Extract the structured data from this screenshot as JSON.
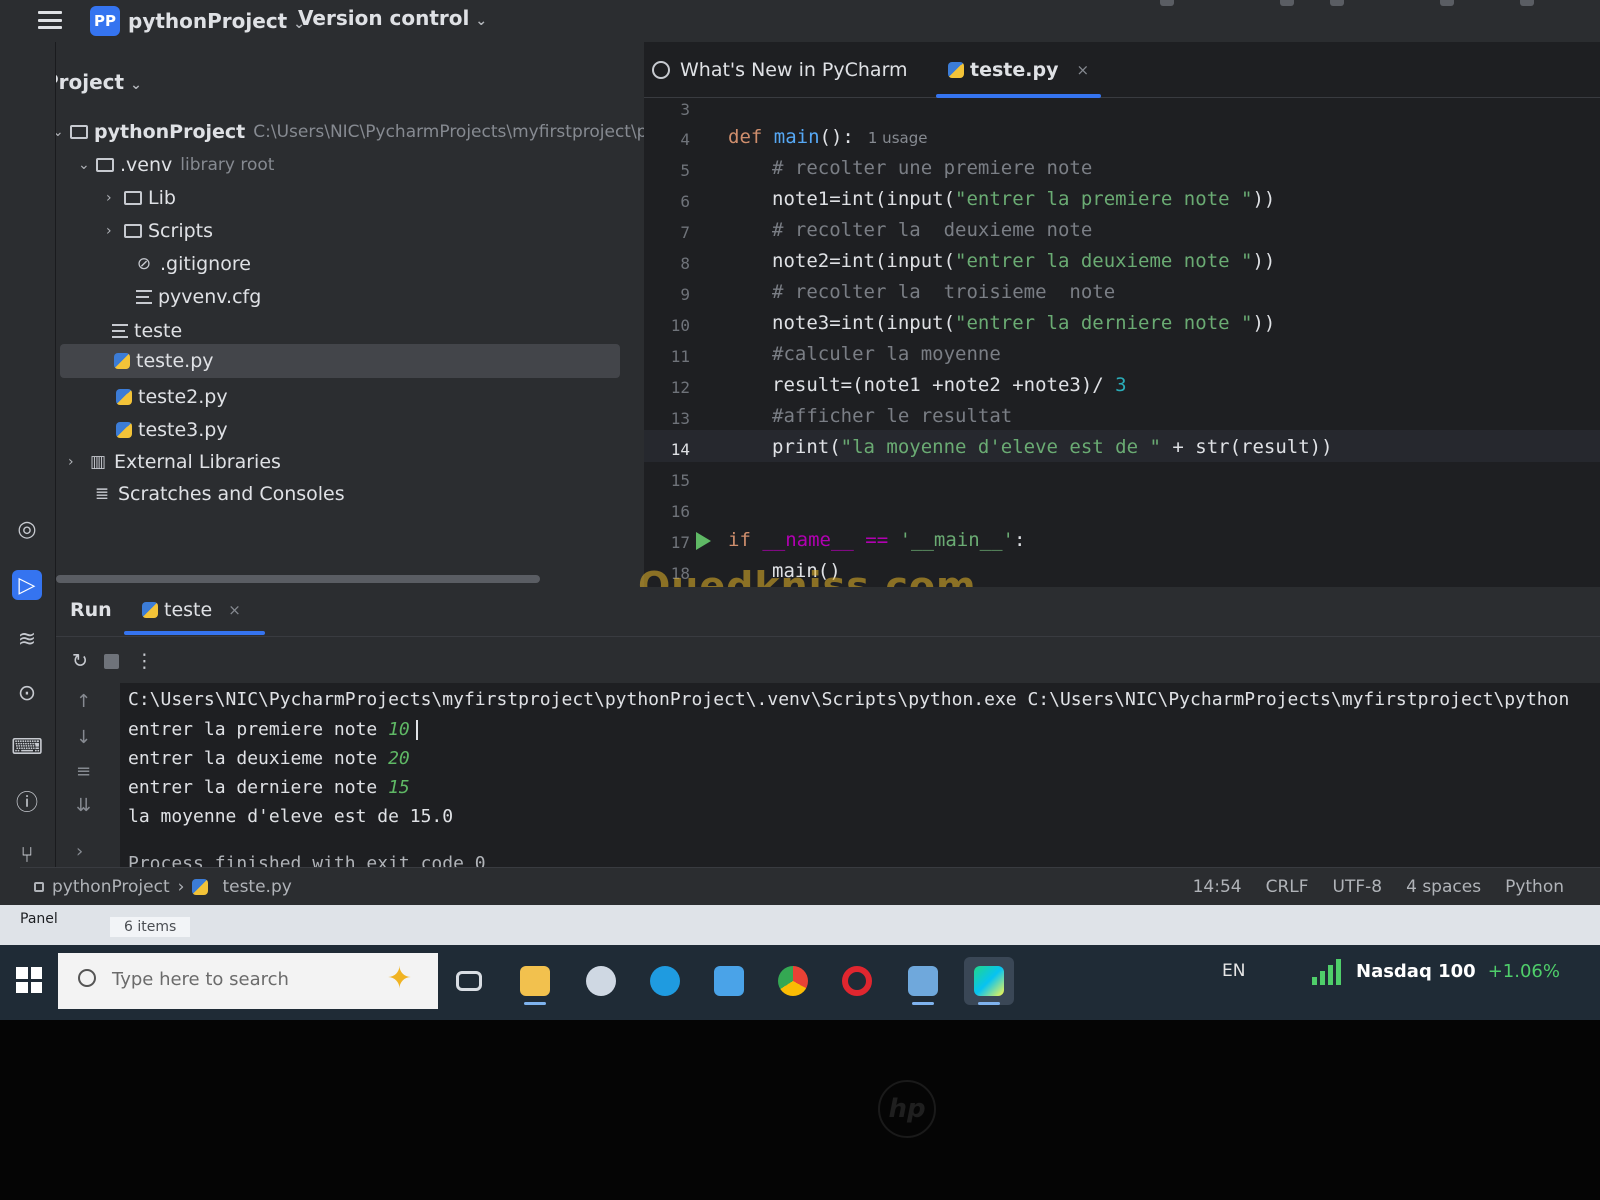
{
  "topbar": {
    "project_badge": "PP",
    "project_name": "pythonProject",
    "vcs_label": "Version control"
  },
  "project_panel": {
    "title": "Project",
    "tree": [
      {
        "label": "pythonProject",
        "hint": "C:\\Users\\NIC\\PycharmProjects\\myfirstproject\\p",
        "type": "folder",
        "expanded": true
      },
      {
        "label": ".venv",
        "hint": "library root",
        "type": "folder",
        "expanded": true
      },
      {
        "label": "Lib",
        "type": "folder",
        "expanded": false
      },
      {
        "label": "Scripts",
        "type": "folder",
        "expanded": false
      },
      {
        "label": ".gitignore",
        "type": "ignore"
      },
      {
        "label": "pyvenv.cfg",
        "type": "text"
      },
      {
        "label": "teste",
        "type": "text"
      },
      {
        "label": "teste.py",
        "type": "python",
        "selected": true
      },
      {
        "label": "teste2.py",
        "type": "python"
      },
      {
        "label": "teste3.py",
        "type": "python"
      },
      {
        "label": "External Libraries",
        "type": "library",
        "expanded": false
      },
      {
        "label": "Scratches and Consoles",
        "type": "scratches"
      }
    ]
  },
  "editor": {
    "tabs": [
      {
        "label": "What's New in PyCharm",
        "icon": "globe-icon",
        "active": false
      },
      {
        "label": "teste.py",
        "icon": "python-file-icon",
        "active": true,
        "close": "×"
      }
    ],
    "line_numbers": [
      "3",
      "4",
      "5",
      "6",
      "7",
      "8",
      "9",
      "10",
      "11",
      "12",
      "13",
      "14",
      "15",
      "16",
      "17",
      "18"
    ],
    "current_line": "14",
    "usage_hint": "1 usage",
    "code": {
      "l4_kw": "def",
      "l4_fn": "main",
      "l4_rest": "():",
      "l5": "# recolter une premiere note",
      "l6_a": "note1=int(input(",
      "l6_s": "\"entrer la premiere note \"",
      "l6_b": "))",
      "l7": "# recolter la  deuxieme note",
      "l8_a": "note2=int(input(",
      "l8_s": "\"entrer la deuxieme note \"",
      "l8_b": "))",
      "l9": "# recolter la  troisieme  note",
      "l10_a": "note3=int(input(",
      "l10_s": "\"entrer la derniere note \"",
      "l10_b": "))",
      "l11": "#calculer la moyenne",
      "l12_a": "result=(note1 +note2 +note3)/ ",
      "l12_n": "3",
      "l13": "#afficher le resultat",
      "l14_a": "print(",
      "l14_s": "\"la moyenne d'eleve est de \"",
      "l14_b": " + str(result))",
      "l17_kw": "if",
      "l17_a": " __name__ == ",
      "l17_s": "'__main__'",
      "l17_b": ":",
      "l18": "main()"
    }
  },
  "watermark": "Ouedkniss.com",
  "run_panel": {
    "run_label": "Run",
    "tab_label": "teste",
    "tab_close": "×",
    "console": {
      "cmd": "C:\\Users\\NIC\\PycharmProjects\\myfirstproject\\pythonProject\\.venv\\Scripts\\python.exe C:\\Users\\NIC\\PycharmProjects\\myfirstproject\\python",
      "lines": [
        {
          "prompt": "entrer la premiere note ",
          "input": "10"
        },
        {
          "prompt": "entrer la deuxieme note ",
          "input": "20"
        },
        {
          "prompt": "entrer la derniere note ",
          "input": "15"
        }
      ],
      "result": "la moyenne d'eleve est de 15.0",
      "finished": "Process finished with exit code 0"
    }
  },
  "status_bar": {
    "breadcrumb": [
      "pythonProject",
      "teste.py"
    ],
    "position": "14:54",
    "line_sep": "CRLF",
    "encoding": "UTF-8",
    "indent": "4 spaces",
    "language": "Python"
  },
  "explorer_strip": {
    "panel_label": "Panel",
    "items_label": "6 items"
  },
  "taskbar": {
    "search_placeholder": "Type here to search",
    "language": "EN",
    "stock_name": "Nasdaq 100",
    "stock_change": "+1.06%",
    "apps": [
      "task-view",
      "file-explorer",
      "weather",
      "edge",
      "store",
      "chrome",
      "opera",
      "remote-app",
      "pycharm"
    ]
  },
  "bezel_logo": "hp"
}
